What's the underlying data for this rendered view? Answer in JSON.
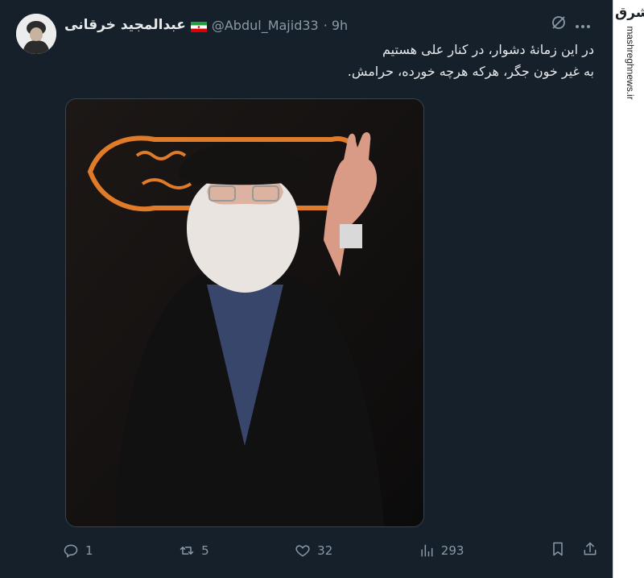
{
  "tweet": {
    "author_name": "عبدالمجید خرقانی",
    "handle": "@Abdul_Majid33",
    "time": "· 9h",
    "text_lines": [
      "در این زمانهٔ دشوار، در کنار علی هستیم",
      "به غیر خون جگر، هرکه هرچه خورده، حرامش."
    ],
    "media_description_icon": "photo"
  },
  "actions": {
    "reply_count": "1",
    "retweet_count": "5",
    "like_count": "32",
    "views_count": "293"
  },
  "sidebar": {
    "logo_text": "مشرق",
    "site_text": "mashreghnews.ir"
  },
  "colors": {
    "background": "#15202b",
    "text": "#e7e9ea",
    "muted": "#8b98a5"
  }
}
